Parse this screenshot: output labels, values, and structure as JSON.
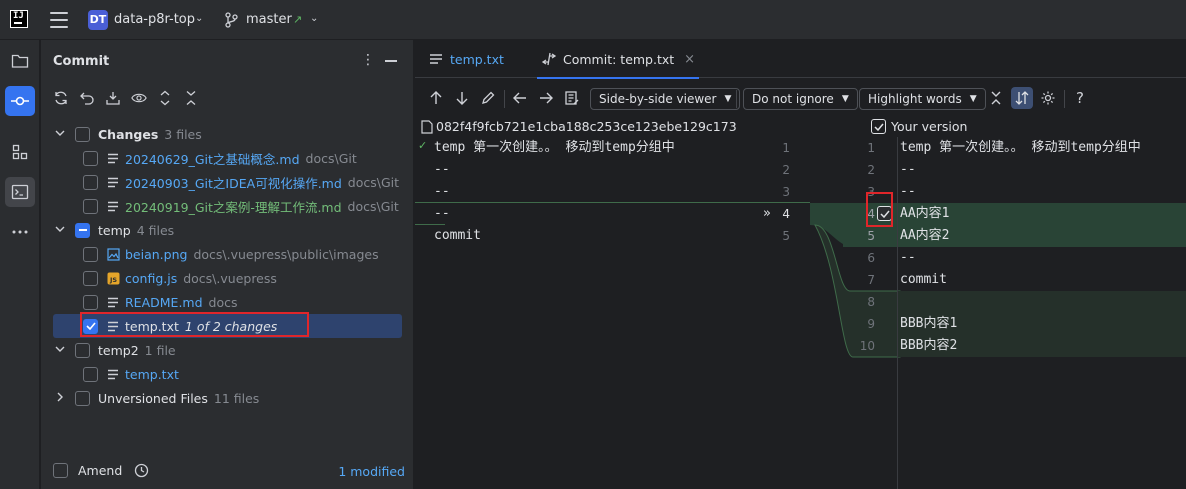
{
  "titlebar": {
    "logo_text": "IJ",
    "project_badge": "DT",
    "project_name": "data-p8r-top",
    "branch_name": "master",
    "branch_arrow": "↗"
  },
  "leftbar": {
    "icons": [
      "folder-icon",
      "commit-icon",
      "structure-icon",
      "terminal-icon",
      "more-icon"
    ]
  },
  "commit_panel": {
    "title": "Commit",
    "tree": [
      {
        "kind": "group",
        "expanded": true,
        "checkbox": "unchecked",
        "label": "Changes",
        "count": "3 files",
        "bold": true
      },
      {
        "kind": "file",
        "checkbox": "unchecked",
        "name": "20240629_Git之基础概念.md",
        "path": "docs\\Git",
        "color": "blue",
        "icon": "text-file-icon"
      },
      {
        "kind": "file",
        "checkbox": "unchecked",
        "name": "20240903_Git之IDEA可视化操作.md",
        "path": "docs\\Git",
        "color": "blue",
        "icon": "text-file-icon"
      },
      {
        "kind": "file",
        "checkbox": "unchecked",
        "name": "20240919_Git之案例-理解工作流.md",
        "path": "docs\\Git",
        "color": "green",
        "icon": "text-file-icon"
      },
      {
        "kind": "group",
        "expanded": true,
        "checkbox": "partial",
        "label": "temp",
        "count": "4 files",
        "bold": false
      },
      {
        "kind": "file",
        "checkbox": "unchecked",
        "name": "beian.png",
        "path": "docs\\.vuepress\\public\\images",
        "color": "blue",
        "icon": "image-file-icon"
      },
      {
        "kind": "file",
        "checkbox": "unchecked",
        "name": "config.js",
        "path": "docs\\.vuepress",
        "color": "blue",
        "icon": "js-file-icon"
      },
      {
        "kind": "file",
        "checkbox": "unchecked",
        "name": "README.md",
        "path": "docs",
        "color": "blue",
        "icon": "text-file-icon"
      },
      {
        "kind": "file",
        "checkbox": "checked",
        "name": "temp.txt",
        "path": "1 of 2 changes",
        "color": "white",
        "icon": "text-file-icon",
        "selected": true
      },
      {
        "kind": "group",
        "expanded": true,
        "checkbox": "unchecked",
        "label": "temp2",
        "count": "1 file",
        "bold": false
      },
      {
        "kind": "file",
        "checkbox": "unchecked",
        "name": "temp.txt",
        "path": "",
        "color": "blue",
        "icon": "text-file-icon"
      },
      {
        "kind": "group",
        "expanded": false,
        "checkbox": "unchecked",
        "label": "Unversioned Files",
        "count": "11 files",
        "bold": false
      }
    ],
    "amend_label": "Amend",
    "modified_label": "1 modified"
  },
  "diff": {
    "tabs": [
      {
        "label": "temp.txt",
        "active": false
      },
      {
        "label": "Commit: temp.txt",
        "active": true
      }
    ],
    "viewer_mode": "Side-by-side viewer",
    "ignore_mode": "Do not ignore",
    "highlight_mode": "Highlight words",
    "left_hash": "082f4f9fcb721e1cba188c253ce123ebe129c173",
    "right_label": "Your version",
    "left_lines": [
      {
        "num": "1",
        "text": "temp 第一次创建。。 移动到temp分组中"
      },
      {
        "num": "2",
        "text": "--"
      },
      {
        "num": "3",
        "text": "--"
      },
      {
        "num": "4",
        "text": "--"
      },
      {
        "num": "5",
        "text": "commit"
      }
    ],
    "right_lines": [
      {
        "num": "1",
        "text": "temp 第一次创建。。 移动到temp分组中"
      },
      {
        "num": "2",
        "text": "--"
      },
      {
        "num": "3",
        "text": "--"
      },
      {
        "num": "4",
        "text": "AA内容1"
      },
      {
        "num": "5",
        "text": "AA内容2"
      },
      {
        "num": "6",
        "text": "--"
      },
      {
        "num": "7",
        "text": "commit"
      },
      {
        "num": "8",
        "text": ""
      },
      {
        "num": "9",
        "text": "BBB内容1"
      },
      {
        "num": "10",
        "text": "BBB内容2"
      }
    ]
  }
}
